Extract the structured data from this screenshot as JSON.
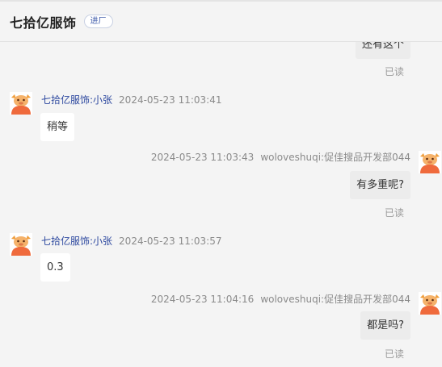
{
  "header": {
    "title": "七拾亿服饰",
    "tag": "进厂"
  },
  "messages": [
    {
      "side": "right",
      "text": "还有这个",
      "read": "已读"
    },
    {
      "side": "left",
      "sender": "七拾亿服饰:小张",
      "time": "2024-05-23 11:03:41",
      "text": "稍等"
    },
    {
      "side": "right",
      "sender": "woloveshuqi:促佳搜品开发部044",
      "time": "2024-05-23 11:03:43",
      "text": "有多重呢?",
      "read": "已读"
    },
    {
      "side": "left",
      "sender": "七拾亿服饰:小张",
      "time": "2024-05-23 11:03:57",
      "text": "0.3"
    },
    {
      "side": "right",
      "sender": "woloveshuqi:促佳搜品开发部044",
      "time": "2024-05-23 11:04:16",
      "text": "都是吗?",
      "read": "已读"
    }
  ]
}
